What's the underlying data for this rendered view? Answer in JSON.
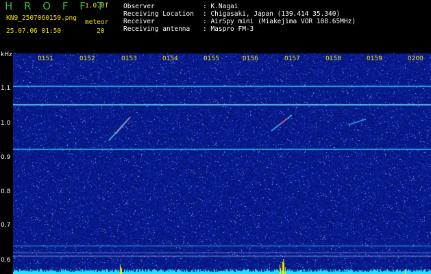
{
  "header": {
    "brand": "H R O F F T",
    "version": "1.0.0f",
    "filename": "KN9_2507060150.png",
    "datetime": "25.07.06 01:50",
    "mode_label": "meteor",
    "mode_value": "20",
    "meta": [
      {
        "label": "Observer",
        "value": ": K.Nagai"
      },
      {
        "label": "Receiving Location",
        "value": ": Chigasaki, Japan (139.414 35.340)"
      },
      {
        "label": "Receiver",
        "value": ": AirSpy mini (Miakejima VOR 108.65MHz)"
      },
      {
        "label": "Receiving antenna",
        "value": ": Maspro FM-3"
      }
    ]
  },
  "axis": {
    "unit": "kHz",
    "y_ticks": [
      "1.1",
      "1.0",
      "0.9",
      "0.8",
      "0.7",
      "0.6"
    ],
    "x_ticks": [
      "0151",
      "0152",
      "0153",
      "0154",
      "0155",
      "0156",
      "0157",
      "0158",
      "0159",
      "0200"
    ]
  },
  "colors": {
    "background": "#000000",
    "plot_bg": "#071a8a",
    "label_yellow": "#f0e000",
    "brand_green": "#2dbf4a",
    "signal_cyan": "#3fe0ff"
  }
}
